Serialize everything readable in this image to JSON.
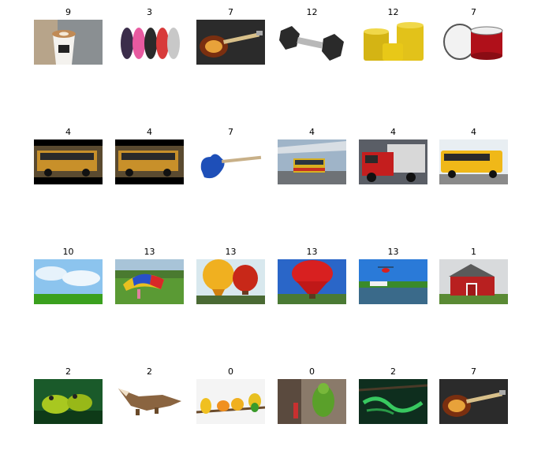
{
  "grid": {
    "rows": [
      {
        "items": [
          {
            "label": "9",
            "subject": "coffee cup with latte art"
          },
          {
            "label": "3",
            "subject": "flip-flop sandals"
          },
          {
            "label": "7",
            "subject": "sunburst bass guitar"
          },
          {
            "label": "12",
            "subject": "hex dumbbell"
          },
          {
            "label": "12",
            "subject": "yellow barrels"
          },
          {
            "label": "7",
            "subject": "red snare drum"
          }
        ]
      },
      {
        "items": [
          {
            "label": "4",
            "subject": "school bus side view"
          },
          {
            "label": "4",
            "subject": "school bus side view"
          },
          {
            "label": "7",
            "subject": "blue electric guitar"
          },
          {
            "label": "4",
            "subject": "city bus at station"
          },
          {
            "label": "4",
            "subject": "red fire truck"
          },
          {
            "label": "4",
            "subject": "yellow school bus"
          }
        ]
      },
      {
        "items": [
          {
            "label": "10",
            "subject": "sky with clouds over grass"
          },
          {
            "label": "13",
            "subject": "parachute game on field"
          },
          {
            "label": "13",
            "subject": "hot air balloons"
          },
          {
            "label": "13",
            "subject": "red hot air balloon"
          },
          {
            "label": "13",
            "subject": "helicopter over lake"
          },
          {
            "label": "1",
            "subject": "red barn"
          }
        ]
      },
      {
        "items": [
          {
            "label": "2",
            "subject": "green frogs"
          },
          {
            "label": "2",
            "subject": "toy crocodile"
          },
          {
            "label": "0",
            "subject": "yellow parakeets on branch"
          },
          {
            "label": "0",
            "subject": "green parrot"
          },
          {
            "label": "2",
            "subject": "green snake"
          },
          {
            "label": "7",
            "subject": "sunburst bass guitar"
          }
        ]
      }
    ]
  }
}
